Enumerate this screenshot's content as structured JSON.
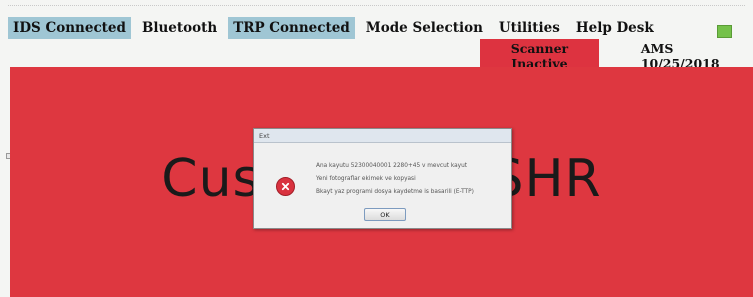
{
  "menu": {
    "items": [
      {
        "label": "IDS Connected",
        "highlight": true
      },
      {
        "label": "Bluetooth",
        "highlight": false
      },
      {
        "label": "TRP Connected",
        "highlight": true
      },
      {
        "label": "Mode Selection",
        "highlight": false
      },
      {
        "label": "Utilities",
        "highlight": false
      },
      {
        "label": "Help Desk",
        "highlight": false
      }
    ]
  },
  "status": {
    "scanner": "Scanner Inactive",
    "ams_date": "AMS 10/25/2018",
    "led_color": "#74c149",
    "scanner_color": "#dd3340"
  },
  "main": {
    "title": "Customs              - DSHR",
    "background_color": "#de3740"
  },
  "dialog": {
    "title": "Ext",
    "icon": "error-icon",
    "line1": "Ana kayutu 52300040001 2280+45 v mevcut kayut",
    "line2": "Yeni fotograflar ekimek ve kopyasi",
    "line3": "Bkayt yaz programi dosya kaydetme is basarili (E-TTP)",
    "ok_label": "OK"
  }
}
